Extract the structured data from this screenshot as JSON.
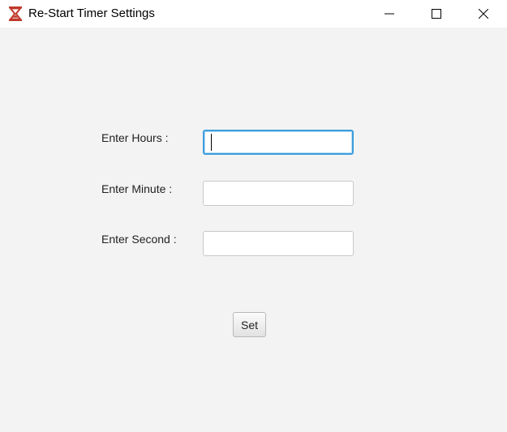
{
  "window": {
    "title": "Re-Start Timer Settings",
    "app_icon": "hourglass-icon",
    "controls": {
      "minimize": "minimize-icon",
      "maximize": "maximize-icon",
      "close": "close-icon"
    }
  },
  "form": {
    "hours": {
      "label": "Enter Hours :",
      "value": "",
      "placeholder": ""
    },
    "minute": {
      "label": "Enter Minute :",
      "value": "",
      "placeholder": ""
    },
    "second": {
      "label": "Enter Second :",
      "value": "",
      "placeholder": ""
    },
    "set_label": "Set"
  },
  "colors": {
    "focus_border": "#3c9ddd",
    "icon_red": "#c0392b"
  }
}
